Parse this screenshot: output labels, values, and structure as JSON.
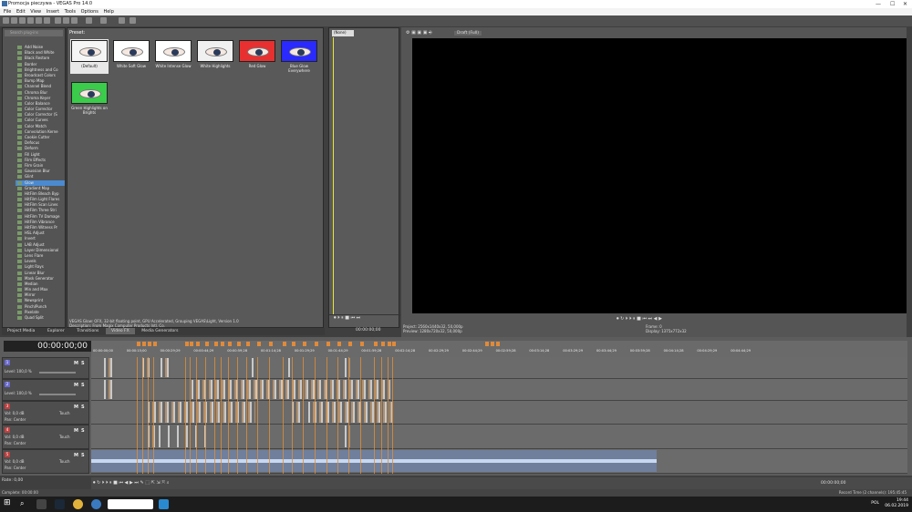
{
  "window": {
    "title": "Promocja pieczywa - VEGAS Pro 14.0",
    "controls": [
      "—",
      "☐",
      "✕"
    ]
  },
  "menu": [
    "File",
    "Edit",
    "View",
    "Insert",
    "Tools",
    "Options",
    "Help"
  ],
  "fx_tree": {
    "search_placeholder": "Search plug-ins",
    "items": [
      "Add Noise",
      "Black and White",
      "Black Restore",
      "Border",
      "Brightness and Co",
      "Broadcast Colors",
      "Bump Map",
      "Channel Blend",
      "Chroma Blur",
      "Chroma Keyer",
      "Color Balance",
      "Color Corrector",
      "Color Corrector (S",
      "Color Curves",
      "Color Match",
      "Convolution Kerne",
      "Cookie Cutter",
      "Defocus",
      "Deform",
      "Fill Light",
      "Film Effects",
      "Film Grain",
      "Gaussian Blur",
      "Glint",
      "Glow",
      "Gradient Map",
      "HitFilm Bleach Byp",
      "HitFilm Light Flares",
      "HitFilm Scan Lines",
      "HitFilm Three Stri",
      "HitFilm TV Damage",
      "HitFilm Vibrance",
      "HitFilm Witness Pr",
      "HSL Adjust",
      "Invert",
      "LAB Adjust",
      "Layer Dimensional",
      "Lens Flare",
      "Levels",
      "Light Rays",
      "Linear Blur",
      "Mask Generator",
      "Median",
      "Min and Max",
      "Mirror",
      "Newsprint",
      "Pinch/Punch",
      "Pixelate",
      "Quad Split"
    ],
    "selected": "Glow"
  },
  "presets": {
    "header": "Preset:",
    "items": [
      {
        "label": "(Default)",
        "bg": "#f5f5f5"
      },
      {
        "label": "White Soft Glow",
        "bg": "#ffffff"
      },
      {
        "label": "White Intense Glow",
        "bg": "#ffffff"
      },
      {
        "label": "White Highlights",
        "bg": "#f0f0f0"
      },
      {
        "label": "Red Glow",
        "bg": "#e83030"
      },
      {
        "label": "Blue Glow Everywhere",
        "bg": "#2a2aff"
      },
      {
        "label": "Green Highlights on Brights",
        "bg": "#3acc4a"
      }
    ],
    "description_line1": "VEGAS Glow: OFX, 32-bit floating point, GPU Accelerated, Grouping VEGAS\\Light, Version 1.0",
    "description_line2": "Description: From Magix Computer Products Intl. Co."
  },
  "tabs": [
    "Project Media",
    "Explorer",
    "Transitions",
    "Video FX",
    "Media Generators"
  ],
  "active_tab": "Video FX",
  "trimmer": {
    "selector": "(None)",
    "timecode": "00:00:00;00"
  },
  "preview": {
    "mode": "Draft (Full)",
    "project": "Project:  2560x1440x32, 50,000p",
    "preview": "Preview:  1280x720x32, 50,000p",
    "frame": "Frame:   0",
    "display": "Display:  1375x772x32"
  },
  "timeline": {
    "timecode": "00:00:00;00",
    "ruler_ticks": [
      "00:00:00;00",
      "00:00:15;00",
      "00:00:29;29",
      "00:00:44;29",
      "00:00:59;28",
      "00:01:14;28",
      "00:01:29;29",
      "00:01:44;29",
      "00:01:59;28",
      "00:02:14;28",
      "00:02:29;29",
      "00:02:44;29",
      "00:02:59;28",
      "00:03:14;28",
      "00:03:29;29",
      "00:03:44;29",
      "00:03:59;28",
      "00:04:14;28",
      "00:04:29;29",
      "00:04:44;29"
    ],
    "tracks": [
      {
        "num": "1",
        "type": "video",
        "level": "Level: 100,0 %"
      },
      {
        "num": "2",
        "type": "video",
        "level": "Level: 100,0 %"
      },
      {
        "num": "3",
        "type": "audio",
        "vol": "Vol:   0,0 dB",
        "pan": "Pan:   Center",
        "mode": "Touch"
      },
      {
        "num": "4",
        "type": "audio",
        "vol": "Vol:   0,0 dB",
        "pan": "Pan:   Center",
        "mode": "Touch"
      },
      {
        "num": "5",
        "type": "audio",
        "vol": "Vol:   0,0 dB",
        "pan": "Pan:   Center",
        "mode": "Touch"
      }
    ],
    "rate": "Rate: 0,00",
    "end_timecode": "00:00:00;00"
  },
  "status": {
    "left": "Complete: 00:00:00",
    "right": "Record Time (2 channels): 195:45:45"
  },
  "taskbar": {
    "time": "19:44",
    "date": "06.02.2019",
    "lang": "POL"
  },
  "colors": {
    "accent": "#4a8ad0",
    "marker": "#e0903a",
    "audio": "#6f7f9c"
  }
}
